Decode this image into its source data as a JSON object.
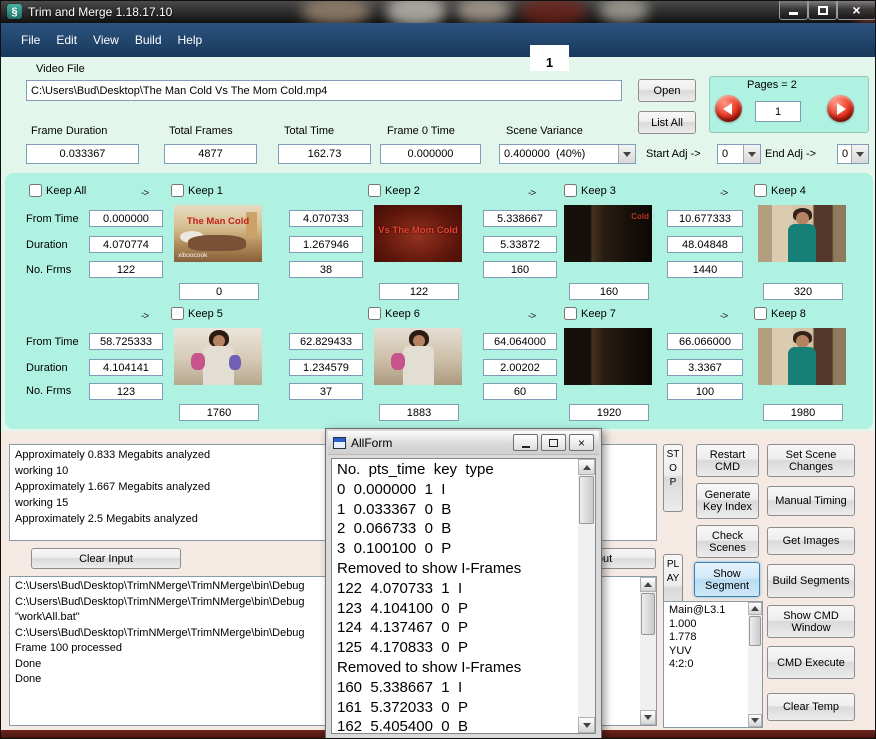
{
  "window": {
    "title": "Trim and Merge 1.18.17.10",
    "icon_glyph": "§",
    "close_glyph": "×"
  },
  "menu": {
    "items": [
      "File",
      "Edit",
      "View",
      "Build",
      "Help"
    ]
  },
  "page_indicator": "1",
  "top": {
    "video_file_label": "Video File",
    "video_file_value": "C:\\Users\\Bud\\Desktop\\The Man Cold Vs The Mom Cold.mp4",
    "open_button": "Open",
    "list_all_button": "List All",
    "pages_label": "Pages = 2",
    "page_value": "1",
    "frame_duration_label": "Frame Duration",
    "frame_duration_value": "0.033367",
    "total_frames_label": "Total Frames",
    "total_frames_value": "4877",
    "total_time_label": "Total Time",
    "total_time_value": "162.73",
    "frame0_time_label": "Frame 0 Time",
    "frame0_time_value": "0.000000",
    "scene_variance_label": "Scene Variance",
    "scene_variance_value": "0.400000  (40%)",
    "start_adj_label": "Start Adj ->",
    "start_adj_value": "0",
    "end_adj_label": "End Adj ->",
    "end_adj_value": "0"
  },
  "grid": {
    "keep_all_label": "Keep All",
    "arrow": "->",
    "from_time_label": "From Time",
    "duration_label": "Duration",
    "no_frms_label": "No. Frms",
    "segments": [
      {
        "keep_label": "Keep 1",
        "from_time": "0.000000",
        "duration": "4.070774",
        "frames": "122",
        "start_frame": "0",
        "caption": "The Man Cold",
        "watermark": "xiboocook"
      },
      {
        "keep_label": "Keep 2",
        "from_time": "4.070733",
        "duration": "1.267946",
        "frames": "38",
        "start_frame": "122",
        "caption": "Vs The Mom Cold",
        "watermark": ""
      },
      {
        "keep_label": "Keep 3",
        "from_time": "5.338667",
        "duration": "5.33872",
        "frames": "160",
        "start_frame": "160",
        "caption": "Cold",
        "watermark": ""
      },
      {
        "keep_label": "Keep 4",
        "from_time": "10.677333",
        "duration": "48.04848",
        "frames": "1440",
        "start_frame": "320",
        "caption": "",
        "watermark": ""
      },
      {
        "keep_label": "Keep 5",
        "from_time": "58.725333",
        "duration": "4.104141",
        "frames": "123",
        "start_frame": "1760",
        "caption": "",
        "watermark": ""
      },
      {
        "keep_label": "Keep 6",
        "from_time": "62.829433",
        "duration": "1.234579",
        "frames": "37",
        "start_frame": "1883",
        "caption": "",
        "watermark": ""
      },
      {
        "keep_label": "Keep 7",
        "from_time": "64.064000",
        "duration": "2.00202",
        "frames": "60",
        "start_frame": "1920",
        "caption": "",
        "watermark": ""
      },
      {
        "keep_label": "Keep 8",
        "from_time": "66.066000",
        "duration": "3.3367",
        "frames": "100",
        "start_frame": "1980",
        "caption": "",
        "watermark": ""
      }
    ]
  },
  "output_top": {
    "lines": [
      "Approximately 0.833 Megabits analyzed",
      "working 10",
      "Approximately 1.667 Megabits analyzed",
      "working 15",
      "Approximately 2.5 Megabits analyzed"
    ]
  },
  "actions": {
    "clear_input": "Clear Input",
    "clear_output": "Clear Output"
  },
  "output_bottom": {
    "lines": [
      "C:\\Users\\Bud\\Desktop\\TrimNMerge\\TrimNMerge\\bin\\Debug",
      "C:\\Users\\Bud\\Desktop\\TrimNMerge\\TrimNMerge\\bin\\Debug",
      "\"work\\All.bat\"",
      "",
      "",
      "C:\\Users\\Bud\\Desktop\\TrimNMerge\\TrimNMerge\\bin\\Debug",
      "Frame 100 processed",
      "Done",
      "Done"
    ]
  },
  "allform": {
    "title": "AllForm",
    "lines": [
      "No.  pts_time  key  type",
      "0  0.000000  1  I",
      "1  0.033367  0  B",
      "2  0.066733  0  B",
      "3  0.100100  0  P",
      "Removed to show I-Frames",
      "122  4.070733  1  I",
      "123  4.104100  0  P",
      "124  4.137467  0  P",
      "125  4.170833  0  P",
      "Removed to show I-Frames",
      "160  5.338667  1  I",
      "161  5.372033  0  P",
      "162  5.405400  0  B"
    ]
  },
  "right_panel": {
    "stop": "STOP",
    "restart_cmd": "Restart CMD",
    "set_scene_changes": "Set Scene Changes",
    "generate_key_index": "Generate Key Index",
    "manual_timing": "Manual Timing",
    "check_scenes": "Check Scenes",
    "get_images": "Get Images",
    "play": "PLAY",
    "show_segment": "Show Segment",
    "build_segments": "Build Segments",
    "info_lines": [
      "Main@L3.1",
      "1.000",
      "1.778",
      "YUV",
      "4:2:0"
    ],
    "show_cmd_window": "Show CMD Window",
    "cmd_execute": "CMD Execute",
    "clear_temp": "Clear Temp"
  }
}
